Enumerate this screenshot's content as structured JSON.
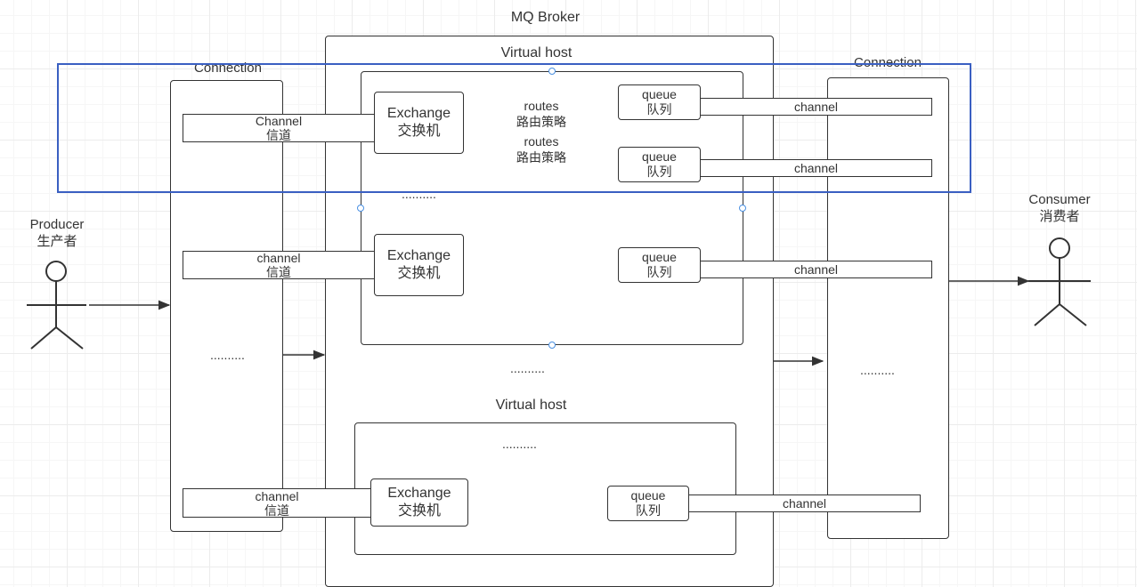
{
  "broker": {
    "title": "MQ Broker"
  },
  "vhosts": [
    {
      "label": "Virtual host"
    },
    {
      "label": "Virtual host"
    }
  ],
  "connections": {
    "producer_side": "Connection",
    "consumer_side": "Connection"
  },
  "producer": {
    "en": "Producer",
    "zh": "生产者"
  },
  "consumer": {
    "en": "Consumer",
    "zh": "消费者"
  },
  "producer_channels": [
    {
      "en": "Channel",
      "zh": "信道"
    },
    {
      "en": "channel",
      "zh": "信道"
    },
    {
      "en": "channel",
      "zh": "信道"
    }
  ],
  "exchanges": [
    {
      "en": "Exchange",
      "zh": "交换机"
    },
    {
      "en": "Exchange",
      "zh": "交换机"
    },
    {
      "en": "Exchange",
      "zh": "交换机"
    }
  ],
  "queues": [
    {
      "en": "queue",
      "zh": "队列"
    },
    {
      "en": "queue",
      "zh": "队列"
    },
    {
      "en": "queue",
      "zh": "队列"
    },
    {
      "en": "queue",
      "zh": "队列"
    }
  ],
  "routes": [
    {
      "en": "routes",
      "zh": "路由策略"
    },
    {
      "en": "routes",
      "zh": "路由策略"
    }
  ],
  "consumer_channels": [
    "channel",
    "channel",
    "channel",
    "channel"
  ],
  "ellipsis": "..........",
  "colors": {
    "selection": "#3a5fc2",
    "handle": "#4a90e2",
    "stroke": "#333333"
  }
}
